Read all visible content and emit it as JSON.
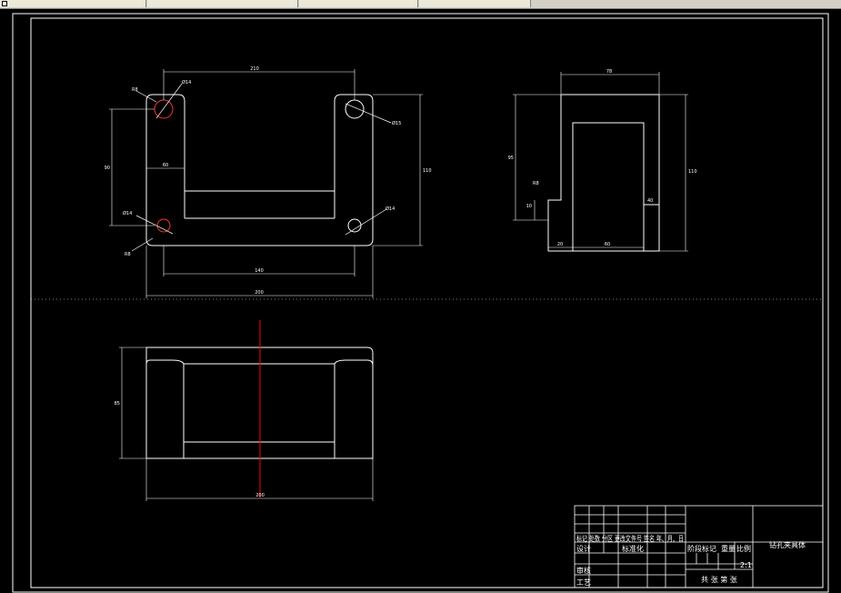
{
  "toolbar": {
    "icons": [
      "layer-icon",
      "dropdown-icon",
      "dropdown-icon",
      "dropdown-icon"
    ]
  },
  "drawing": {
    "top_view": {
      "dim_top": "210",
      "dim_left": "90",
      "dim_right": "110",
      "dim_inner_width": "60",
      "dim_bottom_inner": "140",
      "dim_bottom_outer": "200",
      "hole_labels": [
        "R8",
        "Ø14",
        "Ø15",
        "Ø14",
        "Ø14",
        "R8"
      ]
    },
    "side_view": {
      "dim_top": "78",
      "dim_left": "95",
      "dim_right": "110",
      "dim_small_left": "R8",
      "dim_small_height": "10",
      "dim_bottom_left": "20",
      "dim_bottom_mid": "60",
      "dim_right_small": "40"
    },
    "front_view": {
      "dim_left": "85",
      "dim_bottom": "200"
    },
    "title_block": {
      "part_name": "钻孔夹具体",
      "row1": "标记 处数  分区  更改文件号 签名 年、月、日",
      "designer_label": "设计",
      "standardize_label": "标准化",
      "stage_label": "阶段标记",
      "weight_label": "重量",
      "scale_label": "比例",
      "scale_value": "2:1",
      "review_label": "审核",
      "process_label": "工艺",
      "sheets_label": "共 张 第 张"
    }
  },
  "colors": {
    "background": "#000000",
    "line": "#ffffff",
    "center_line": "#ff0000"
  }
}
